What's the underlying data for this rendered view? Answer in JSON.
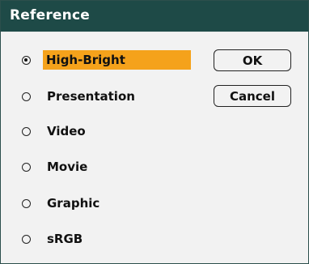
{
  "dialog": {
    "title": "Reference"
  },
  "options": [
    {
      "label": "High-Bright",
      "selected": true
    },
    {
      "label": "Presentation",
      "selected": false
    },
    {
      "label": "Video",
      "selected": false
    },
    {
      "label": "Movie",
      "selected": false
    },
    {
      "label": "Graphic",
      "selected": false
    },
    {
      "label": "sRGB",
      "selected": false
    }
  ],
  "buttons": {
    "ok_label": "OK",
    "cancel_label": "Cancel"
  },
  "colors": {
    "titlebar": "#1e4a47",
    "highlight": "#f5a21b",
    "background": "#f2f2f2"
  }
}
